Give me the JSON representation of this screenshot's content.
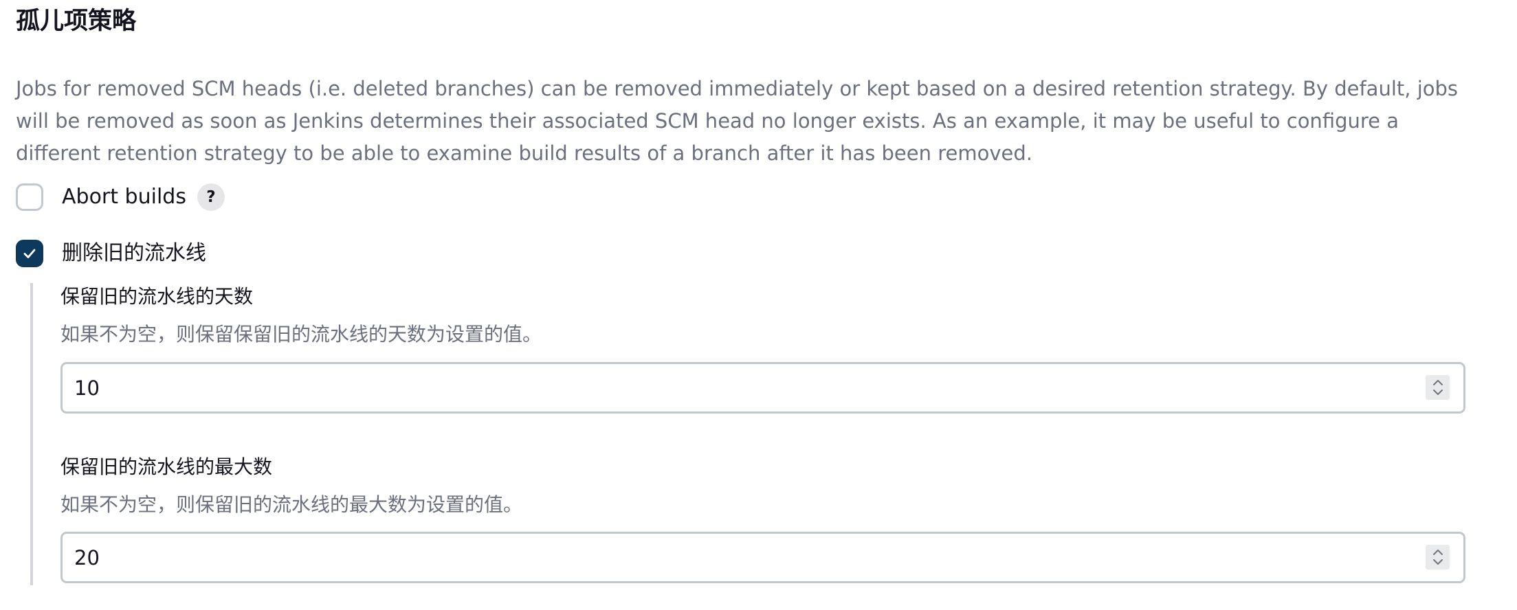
{
  "section": {
    "title": "孤儿项策略",
    "description": "Jobs for removed SCM heads (i.e. deleted branches) can be removed immediately or kept based on a desired retention strategy. By default, jobs will be removed as soon as Jenkins determines their associated SCM head no longer exists. As an example, it may be useful to configure a different retention strategy to be able to examine build results of a branch after it has been removed."
  },
  "abort_builds": {
    "label": "Abort builds",
    "checked": false,
    "help_label": "?"
  },
  "discard_old": {
    "label": "删除旧的流水线",
    "checked": true,
    "fields": [
      {
        "label": "保留旧的流水线的天数",
        "help": "如果不为空，则保留保留旧的流水线的天数为设置的值。",
        "value": "10"
      },
      {
        "label": "保留旧的流水线的最大数",
        "help": "如果不为空，则保留旧的流水线的最大数为设置的值。",
        "value": "20"
      }
    ]
  },
  "icons": {
    "checkmark": "check-icon",
    "spinner": "spinner-updown-icon",
    "help": "question-mark-icon"
  },
  "colors": {
    "checked_bg": "#0d3a5c",
    "muted_text": "#6b6f7e",
    "border": "#c2c7ce"
  }
}
